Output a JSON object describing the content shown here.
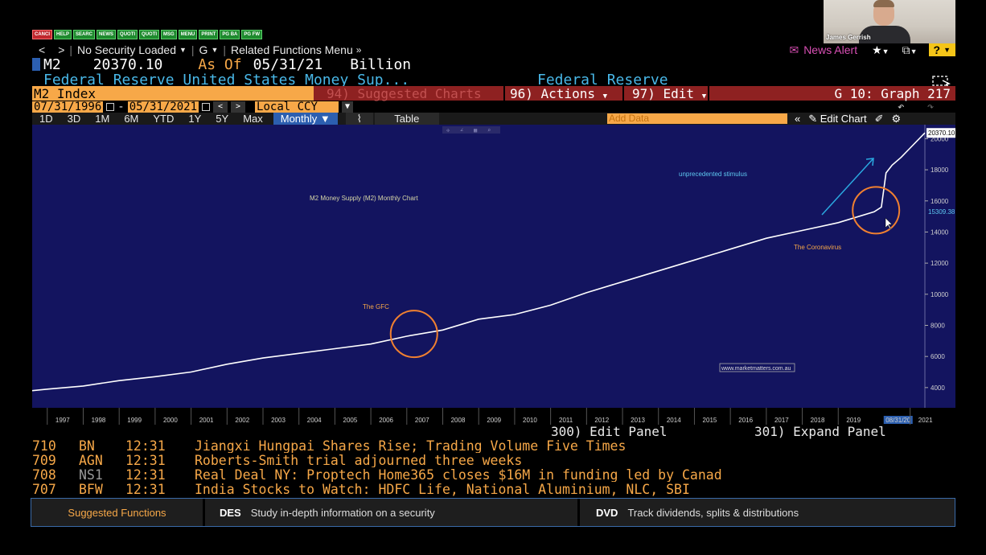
{
  "quick_buttons": [
    "CANCI",
    "HELP",
    "SEARC",
    "NEWS",
    "QUOTI",
    "QUOTI",
    "MSG",
    "MENU",
    "PRINT",
    "PG BA",
    "PG FW"
  ],
  "webcam": {
    "name": "James Gerrish"
  },
  "nav": {
    "back": "<",
    "forward": ">",
    "security": "No Security Loaded",
    "g": "G",
    "related": "Related Functions Menu",
    "news_alert": "News Alert",
    "help": "?"
  },
  "security": {
    "ticker": "M2",
    "value": "20370.10",
    "as_of_label": "As Of",
    "date": "05/31/21",
    "unit": "Billion",
    "name": "Federal Reserve United States Money Sup...",
    "source": "Federal Reserve"
  },
  "tabs": {
    "index": "M2 Index",
    "suggested": "94) Suggested Charts",
    "actions": "96) Actions",
    "edit": "97) Edit",
    "graph": "G 10: Graph 217"
  },
  "dates": {
    "start": "07/31/1996",
    "dash": "-",
    "end": "05/31/2021",
    "ccy": "Local CCY"
  },
  "periods": [
    "1D",
    "3D",
    "1M",
    "6M",
    "YTD",
    "1Y",
    "5Y",
    "Max"
  ],
  "frequency": "Monthly",
  "table_label": "Table",
  "add_data_placeholder": "Add Data",
  "edit_chart": "Edit Chart",
  "chart_data": {
    "type": "line",
    "title": "M2 Money Supply (M2) Monthly Chart",
    "x": [
      1996.58,
      1997,
      1998,
      1999,
      2000,
      2001,
      2002,
      2003,
      2004,
      2005,
      2006,
      2007,
      2008,
      2009,
      2010,
      2011,
      2012,
      2013,
      2014,
      2015,
      2016,
      2017,
      2018,
      2019,
      2020.0,
      2020.2,
      2020.33,
      2020.5,
      2020.75,
      2021.0,
      2021.41
    ],
    "y": [
      3800,
      3900,
      4100,
      4450,
      4700,
      5000,
      5500,
      5900,
      6200,
      6500,
      6800,
      7300,
      7700,
      8400,
      8700,
      9300,
      10100,
      10800,
      11500,
      12200,
      12900,
      13600,
      14100,
      14600,
      15300,
      15600,
      17800,
      18300,
      18800,
      19400,
      20370.1
    ],
    "xlim": [
      1996.58,
      2021.41
    ],
    "ylim": [
      2700,
      20900
    ],
    "yticks": [
      4000,
      6000,
      8000,
      10000,
      12000,
      14000,
      16000,
      18000,
      20000
    ],
    "xticks": [
      "1997",
      "1998",
      "1999",
      "2000",
      "2001",
      "2002",
      "2003",
      "2004",
      "2005",
      "2006",
      "2007",
      "2008",
      "2009",
      "2010",
      "2011",
      "2012",
      "2013",
      "2014",
      "2015",
      "2016",
      "2017",
      "2018",
      "2019",
      "08/31/20",
      "2021"
    ],
    "last_value_label": "20370.10",
    "marker_value_label": "15309.38",
    "annotations": {
      "gfc": "The GFC",
      "coronavirus": "The Coronavirus",
      "stimulus": "unprecedented stimulus",
      "watermark": "www.marketmatters.com.au"
    },
    "colors": {
      "background": "#13145f",
      "line": "#ffffff",
      "annotation": "#f7a848",
      "arrow": "#2aa8e0",
      "circle": "#f08030"
    },
    "grid": false,
    "legend": "none"
  },
  "panel": {
    "edit": "300) Edit Panel",
    "expand": "301) Expand Panel"
  },
  "news": [
    {
      "num": "710",
      "src": "BN",
      "time": "12:31",
      "headline": "Jiangxi Hungpai Shares Rise; Trading Volume Five Times"
    },
    {
      "num": "709",
      "src": "AGN",
      "time": "12:31",
      "headline": "Roberts-Smith trial adjourned three weeks"
    },
    {
      "num": "708",
      "src": "NS1",
      "time": "12:31",
      "headline": "Real Deal NY: Proptech Home365 closes $16M in funding led by Canad"
    },
    {
      "num": "707",
      "src": "BFW",
      "time": "12:31",
      "headline": "India Stocks to Watch: HDFC Life, National Aluminium, NLC, SBI"
    }
  ],
  "footer": {
    "suggested": "Suggested Functions",
    "des_code": "DES",
    "des_text": "Study in-depth information on a security",
    "dvd_code": "DVD",
    "dvd_text": "Track dividends, splits & distributions"
  }
}
